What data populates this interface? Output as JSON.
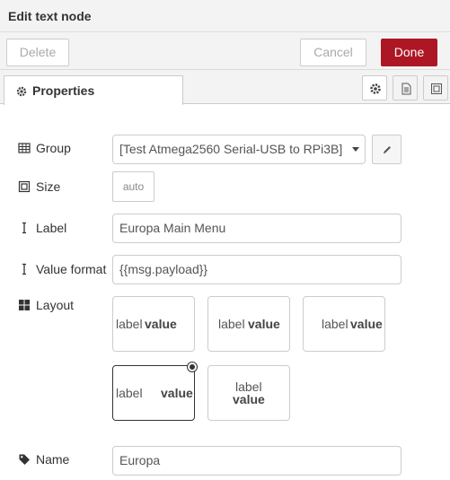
{
  "header": {
    "title": "Edit text node"
  },
  "toolbar": {
    "delete_label": "Delete",
    "cancel_label": "Cancel",
    "done_label": "Done"
  },
  "tabs": {
    "properties_label": "Properties"
  },
  "form": {
    "group": {
      "label": "Group",
      "value": "[Test Atmega2560 Serial-USB to RPi3B]"
    },
    "size": {
      "label": "Size",
      "value": "auto"
    },
    "label_field": {
      "label": "Label",
      "value": "Europa Main Menu"
    },
    "value_format": {
      "label": "Value format",
      "value": "{{msg.payload}}"
    },
    "layout": {
      "label": "Layout",
      "selected_index": 3,
      "options": [
        {
          "label": "label",
          "value": "value"
        },
        {
          "label": "label",
          "value": "value"
        },
        {
          "label": "label",
          "value": "value"
        },
        {
          "label": "label",
          "value": "value"
        },
        {
          "label": "label",
          "value": "value"
        }
      ]
    },
    "name": {
      "label": "Name",
      "value": "Europa"
    }
  },
  "colors": {
    "done": "#ad1625",
    "header_bg": "#f3f3f3",
    "border": "#cccccc"
  }
}
